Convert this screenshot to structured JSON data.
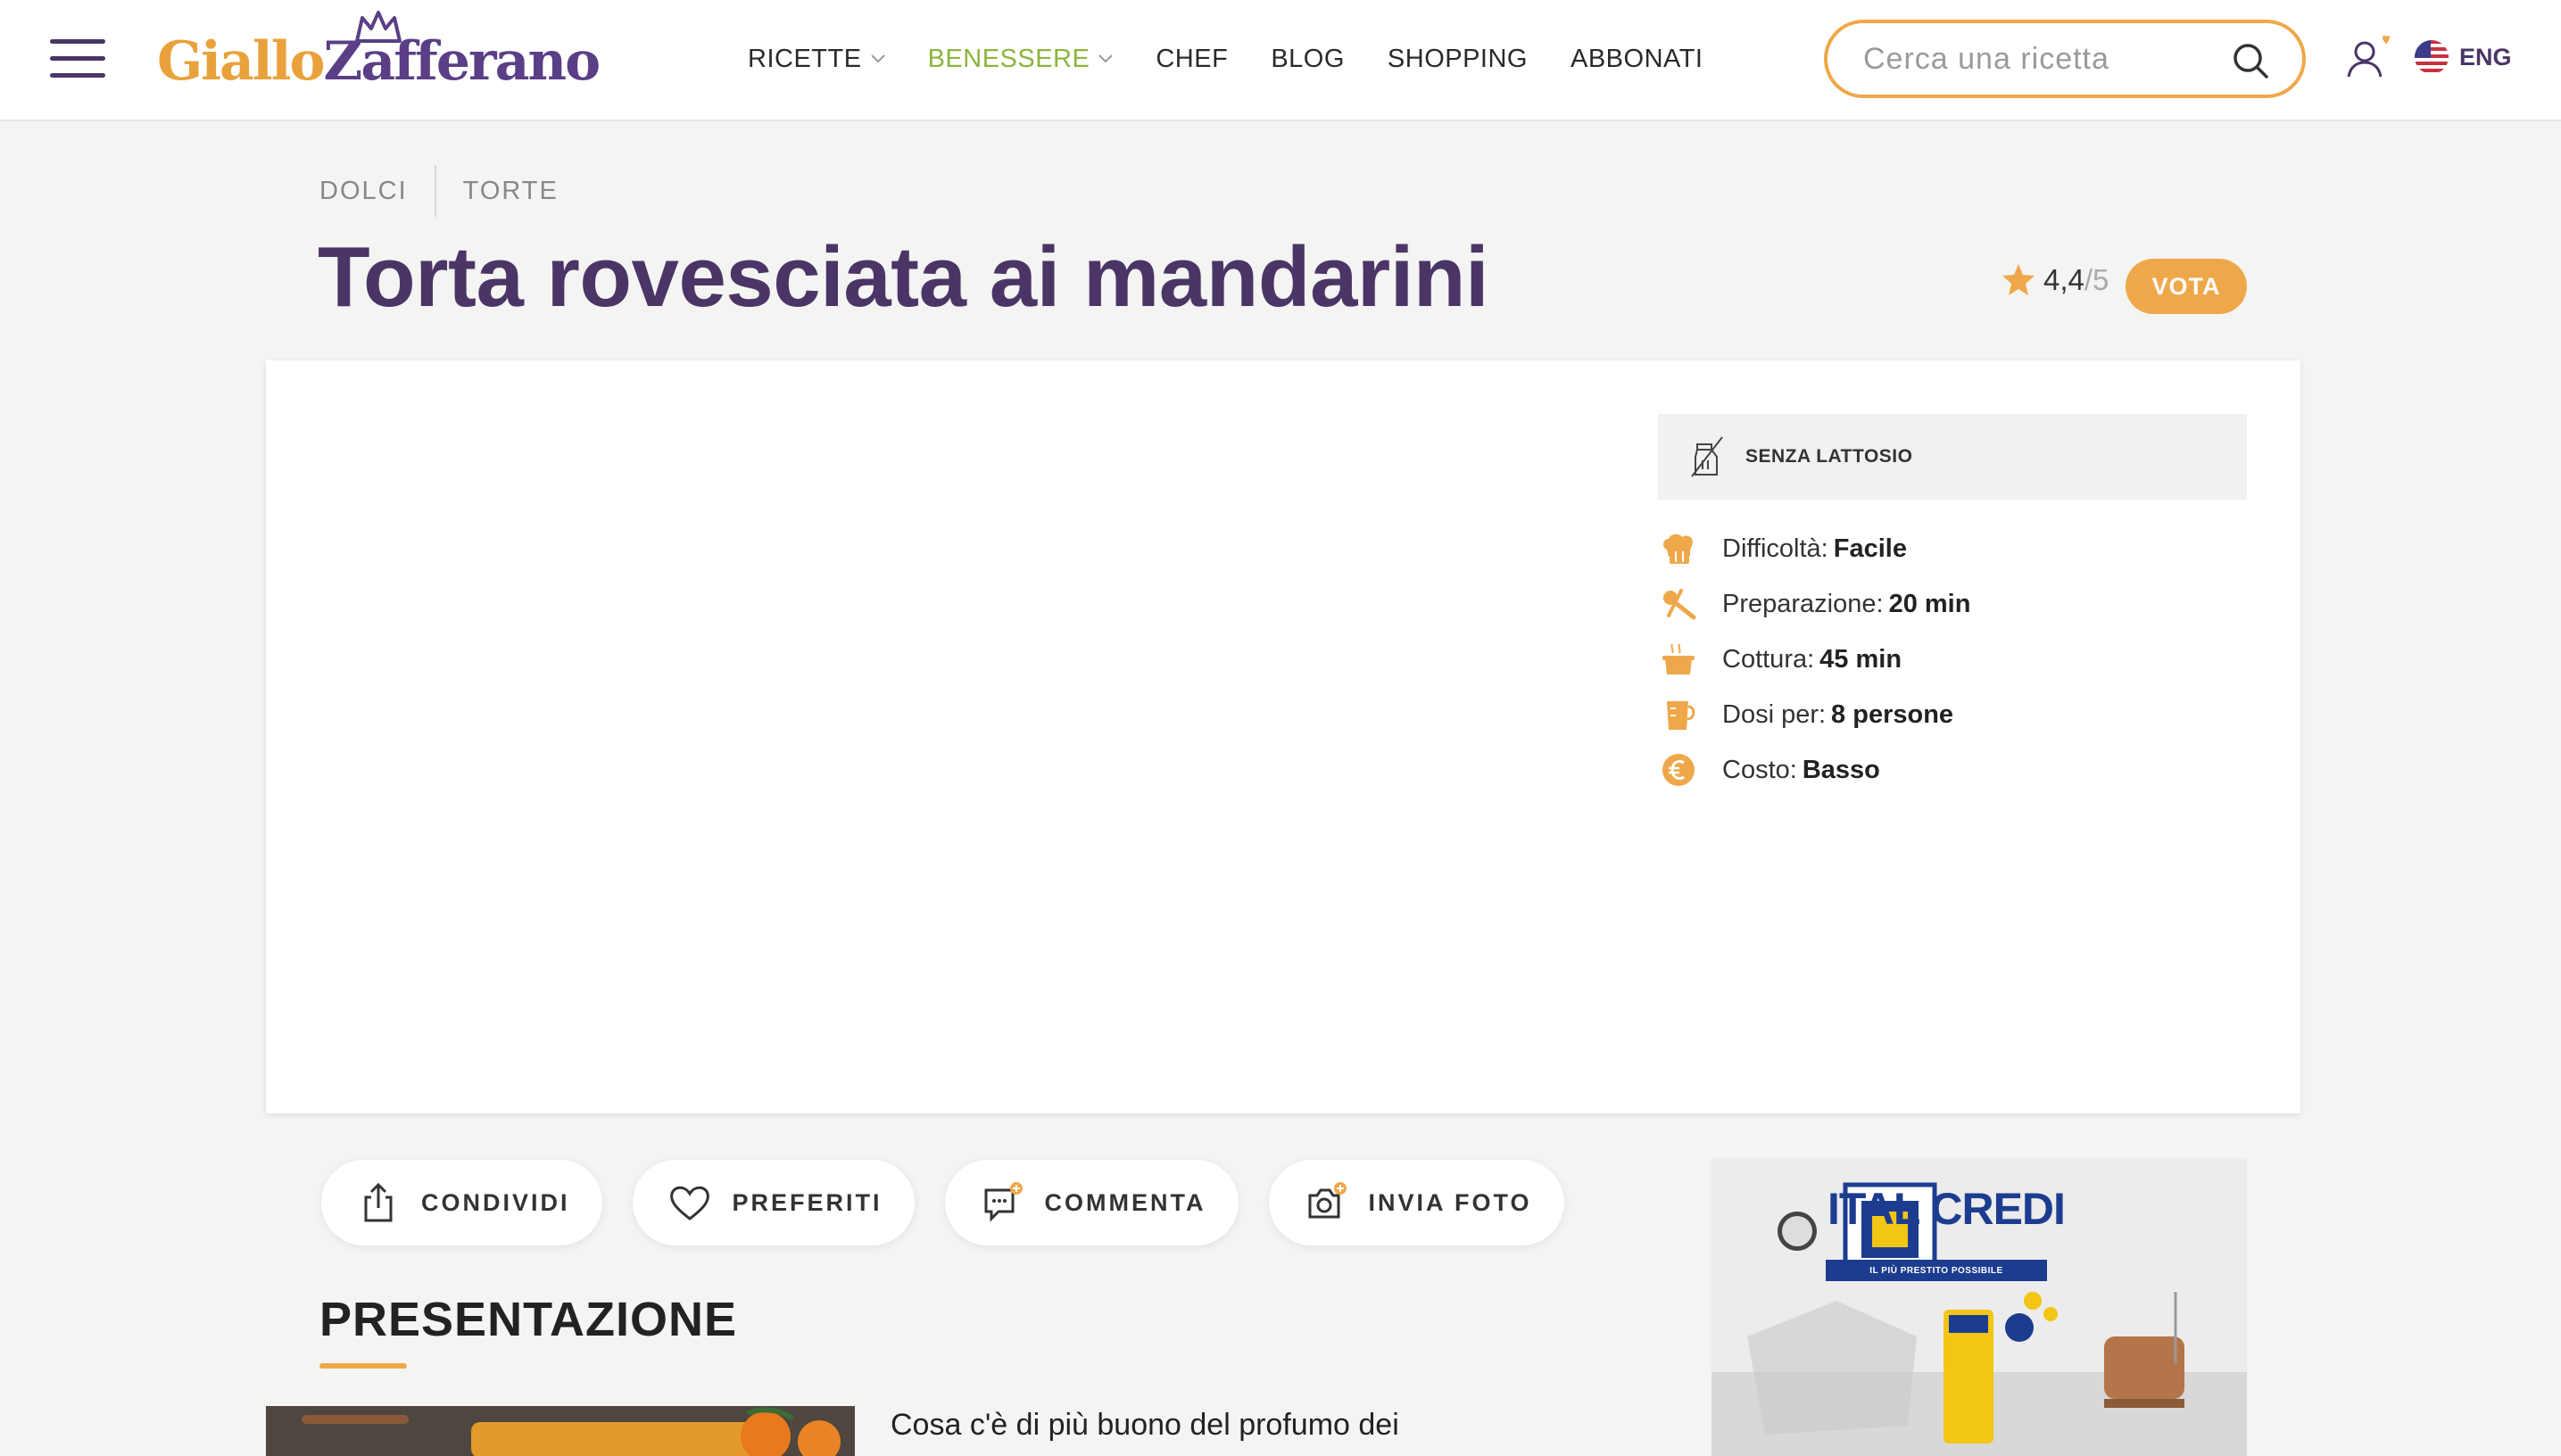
{
  "header": {
    "logo": {
      "part1": "Giallo",
      "part2": "Zafferano"
    },
    "nav": [
      {
        "label": "RICETTE",
        "dropdown": true
      },
      {
        "label": "BENESSERE",
        "dropdown": true,
        "active": true
      },
      {
        "label": "CHEF"
      },
      {
        "label": "BLOG"
      },
      {
        "label": "SHOPPING"
      },
      {
        "label": "ABBONATI"
      }
    ],
    "search": {
      "placeholder": "Cerca una ricetta",
      "value": ""
    },
    "language": "ENG"
  },
  "breadcrumb": [
    "DOLCI",
    "TORTE"
  ],
  "recipe": {
    "title": "Torta rovesciata ai mandarini",
    "rating": {
      "value": "4,4",
      "max": "/5"
    },
    "vote_label": "VOTA",
    "tag": "SENZA LATTOSIO",
    "info": [
      {
        "label": "Difficoltà:",
        "value": "Facile",
        "icon": "chef-hat-icon"
      },
      {
        "label": "Preparazione:",
        "value": "20 min",
        "icon": "whisk-icon"
      },
      {
        "label": "Cottura:",
        "value": "45 min",
        "icon": "pot-icon"
      },
      {
        "label": "Dosi per:",
        "value": "8 persone",
        "icon": "measuring-cup-icon"
      },
      {
        "label": "Costo:",
        "value": "Basso",
        "icon": "euro-icon"
      }
    ]
  },
  "actions": [
    {
      "label": "CONDIVIDI",
      "icon": "share-icon"
    },
    {
      "label": "PREFERITI",
      "icon": "heart-icon"
    },
    {
      "label": "COMMENTA",
      "icon": "comment-icon"
    },
    {
      "label": "INVIA FOTO",
      "icon": "camera-icon"
    }
  ],
  "presentation": {
    "title": "PRESENTAZIONE",
    "intro": "Cosa c'è di più buono del profumo dei"
  },
  "ad": {
    "brand": "ITAL CREDI",
    "tagline": "IL PIÙ PRESTITO POSSIBILE"
  },
  "colors": {
    "brand_purple": "#4a3566",
    "brand_orange": "#eea84a",
    "active_green": "#8bb53d"
  }
}
